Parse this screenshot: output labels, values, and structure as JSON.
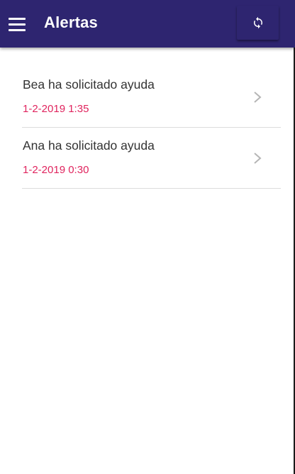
{
  "header": {
    "title": "Alertas",
    "menu_icon": "hamburger-menu-icon",
    "refresh_icon": "refresh-icon",
    "background_color": "#2e2570"
  },
  "alerts": [
    {
      "title": "Bea ha solicitado ayuda",
      "date": "1-2-2019 1:35",
      "icon": "chevron-right-icon"
    },
    {
      "title": "Ana ha solicitado ayuda",
      "date": "1-2-2019 0:30",
      "icon": "chevron-right-icon"
    }
  ],
  "colors": {
    "date_text": "#e0245e",
    "title_text": "#333333",
    "divider": "#dcdcdc"
  }
}
